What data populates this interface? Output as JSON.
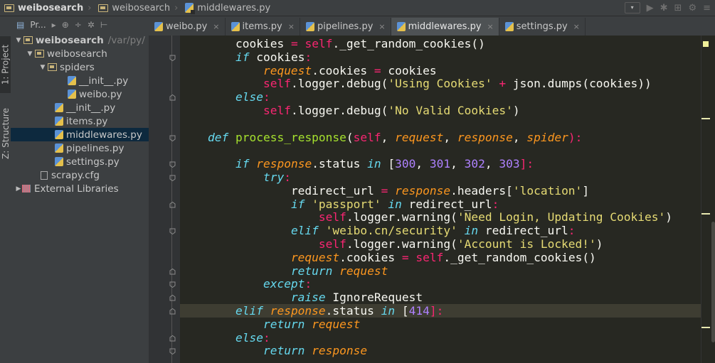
{
  "breadcrumb": {
    "items": [
      {
        "label": "weibosearch",
        "icon": "folder-icon"
      },
      {
        "label": "weibosearch",
        "icon": "folder-icon"
      },
      {
        "label": "middlewares.py",
        "icon": "python-file-icon"
      }
    ]
  },
  "project_panel": {
    "tool_window_tabs": [
      "1: Project",
      "Z: Structure"
    ],
    "view_selector": "Pr..."
  },
  "tree": [
    {
      "label": "weibosearch",
      "extra": "/var/py/",
      "level": 0,
      "type": "folder",
      "expanded": true,
      "bold": true
    },
    {
      "label": "weibosearch",
      "level": 1,
      "type": "folder",
      "expanded": true
    },
    {
      "label": "spiders",
      "level": 2,
      "type": "folder",
      "expanded": true
    },
    {
      "label": "__init__.py",
      "level": 3,
      "type": "py"
    },
    {
      "label": "weibo.py",
      "level": 3,
      "type": "py"
    },
    {
      "label": "__init__.py",
      "level": 2,
      "type": "py"
    },
    {
      "label": "items.py",
      "level": 2,
      "type": "py"
    },
    {
      "label": "middlewares.py",
      "level": 2,
      "type": "py",
      "selected": true
    },
    {
      "label": "pipelines.py",
      "level": 2,
      "type": "py"
    },
    {
      "label": "settings.py",
      "level": 2,
      "type": "py"
    },
    {
      "label": "scrapy.cfg",
      "level": 1,
      "type": "cfg"
    },
    {
      "label": "External Libraries",
      "level": 0,
      "type": "lib",
      "expanded": false
    }
  ],
  "tabs": [
    {
      "label": "weibo.py",
      "active": false
    },
    {
      "label": "items.py",
      "active": false
    },
    {
      "label": "pipelines.py",
      "active": false
    },
    {
      "label": "middlewares.py",
      "active": true
    },
    {
      "label": "settings.py",
      "active": false
    }
  ],
  "code_lines": [
    "        cookies = self._get_random_cookies()",
    "        if cookies:",
    "            request.cookies = cookies",
    "            self.logger.debug('Using Cookies' + json.dumps(cookies))",
    "        else:",
    "            self.logger.debug('No Valid Cookies')",
    "",
    "    def process_response(self, request, response, spider):",
    "",
    "        if response.status in [300, 301, 302, 303]:",
    "            try:",
    "                redirect_url = response.headers['location']",
    "                if 'passport' in redirect_url:",
    "                    self.logger.warning('Need Login, Updating Cookies')",
    "                elif 'weibo.cn/security' in redirect_url:",
    "                    self.logger.warning('Account is Locked!')",
    "                request.cookies = self._get_random_cookies()",
    "                return request",
    "            except:",
    "                raise IgnoreRequest",
    "        elif response.status in [414]:",
    "            return request",
    "        else:",
    "            return response"
  ],
  "current_line_index": 20,
  "colors": {
    "keyword": "#66d9ef",
    "self": "#f92672",
    "param": "#fd971f",
    "string": "#e6db74",
    "number": "#ae81ff",
    "function": "#a6e22e",
    "background": "#272822"
  }
}
